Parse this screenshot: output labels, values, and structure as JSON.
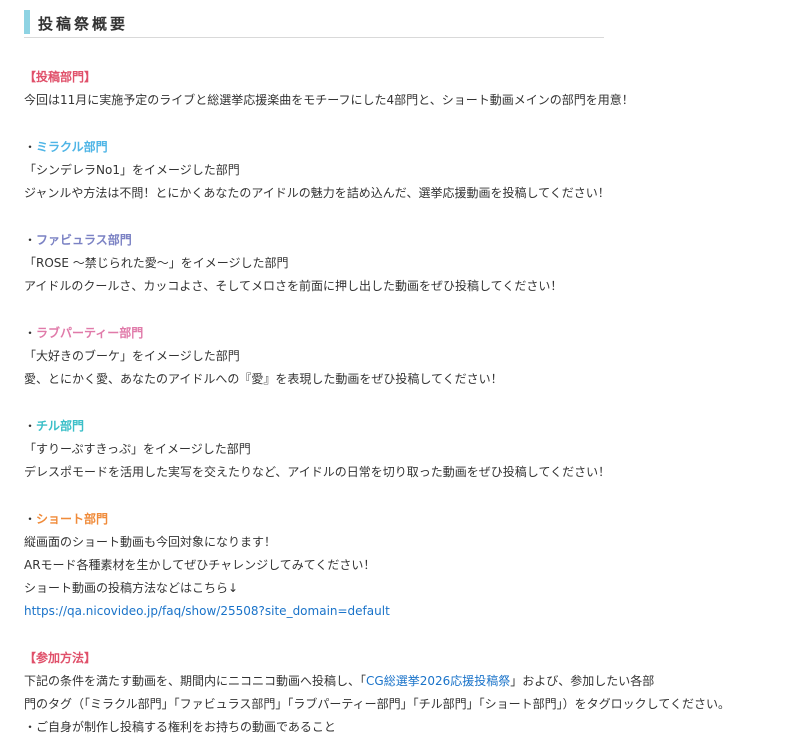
{
  "page": {
    "title": "投稿祭概要"
  },
  "posting_section": {
    "label": "【投稿部門】",
    "intro": "今回は11月に実施予定のライブと総選挙応援楽曲をモチーフにした4部門と、ショート動画メインの部門を用意！"
  },
  "departments": [
    {
      "bullet": "・",
      "name": "ミラクル部門",
      "image_line": "「シンデレラNo1」をイメージした部門",
      "description": "ジャンルや方法は不問！とにかくあなたのアイドルの魅力を詰め込んだ、選挙応援動画を投稿してください！"
    },
    {
      "bullet": "・",
      "name": "ファビュラス部門",
      "image_line": "「ROSE ～禁じられた愛～」をイメージした部門",
      "description": "アイドルのクールさ、カッコよさ、そしてメロさを前面に押し出した動画をぜひ投稿してください！"
    },
    {
      "bullet": "・",
      "name": "ラブパーティー部門",
      "image_line": "「大好きのブーケ」をイメージした部門",
      "description": "愛、とにかく愛、あなたのアイドルへの『愛』を表現した動画をぜひ投稿してください！"
    },
    {
      "bullet": "・",
      "name": "チル部門",
      "image_line": "「すりーぷすきっぷ」をイメージした部門",
      "description": "デレスポモードを活用した実写を交えたりなど、アイドルの日常を切り取った動画をぜひ投稿してください！"
    }
  ],
  "short_department": {
    "bullet": "・",
    "name": "ショート部門",
    "lines": [
      "縦画面のショート動画も今回対象になります！",
      "ARモード各種素材を生かしてぜひチャレンジしてみてください！",
      "ショート動画の投稿方法などはこちら↓"
    ],
    "link_text": "https://qa.nicovideo.jp/faq/show/25508?site_domain=default"
  },
  "participation": {
    "label": "【参加方法】",
    "line1_before": "下記の条件を満たす動画を、期間内にニコニコ動画へ投稿し、「",
    "line1_link": "CG総選挙2026応援投稿祭",
    "line1_after": "」および、参加したい各部",
    "line2": "門のタグ（「ミラクル部門」「ファビュラス部門」「ラブパーティー部門」「チル部門」「ショート部門」）をタグロックしてください。",
    "line3": "・ご自身が制作し投稿する権利をお持ちの動画であること"
  },
  "colors": {
    "accent_bar": "#8ed3e3",
    "label_red": "#e0506a",
    "miracle": "#4fb5e6",
    "fabulous": "#7b82c4",
    "love_party": "#e07aa9",
    "chill": "#3bbfc8",
    "short": "#f08b3a",
    "link": "#1a73c9"
  }
}
